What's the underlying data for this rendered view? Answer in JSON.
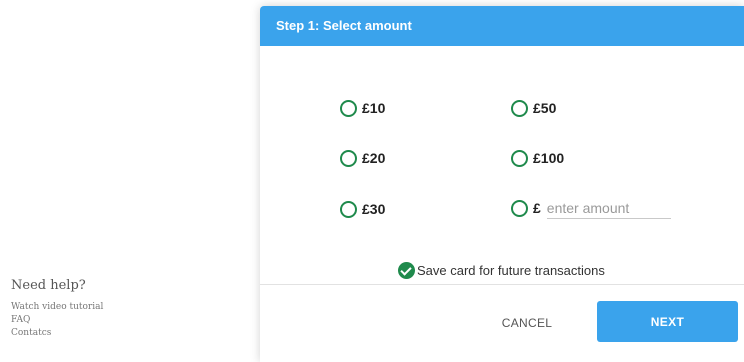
{
  "card": {
    "title": "Step 1: Select amount",
    "currency_symbol": "£",
    "amount_options": [
      {
        "label": "£10"
      },
      {
        "label": "£20"
      },
      {
        "label": "£30"
      },
      {
        "label": "£50"
      },
      {
        "label": "£100"
      }
    ],
    "custom_amount": {
      "prefix": "£",
      "placeholder": "enter amount",
      "value": ""
    },
    "save_card_label": "Save card for future transactions",
    "save_card_checked": true,
    "cancel_label": "CANCEL",
    "next_label": "NEXT"
  },
  "help": {
    "title": "Need help?",
    "links": [
      "Watch video tutorial",
      "FAQ",
      "Contatcs"
    ]
  },
  "colors": {
    "header_blue": "#3aa3ec",
    "radio_green": "#1f8a4c",
    "button_blue": "#3aa3ec"
  }
}
